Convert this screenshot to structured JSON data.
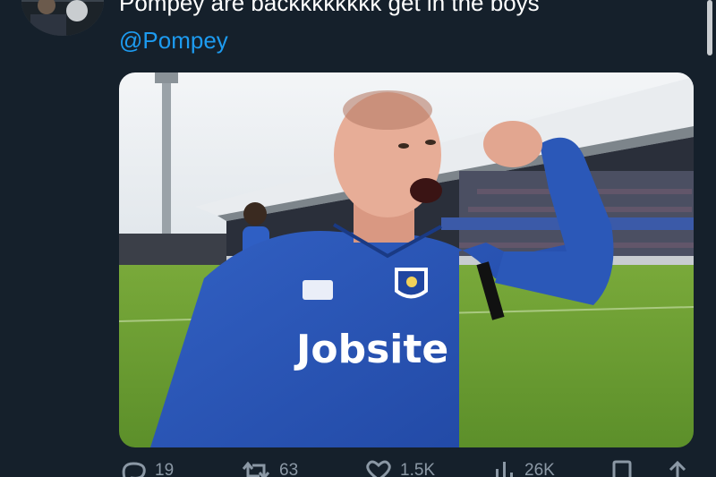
{
  "tweet": {
    "text": "Pompey are backkkkkkkk get in the boys",
    "mention": "@Pompey"
  },
  "media": {
    "shirt_sponsor": "Jobsite",
    "brand_colors": {
      "shirt": "#2a55b8",
      "pitch": "#6a9e30",
      "sky": "#eef2f5"
    }
  },
  "actions": {
    "reply_count": "19",
    "retweet_count": "63",
    "like_count": "1.5K",
    "views_count": "26K"
  },
  "colors": {
    "background": "#15202b",
    "text": "#ffffff",
    "link": "#1d9bf0",
    "muted": "#8b98a5"
  }
}
